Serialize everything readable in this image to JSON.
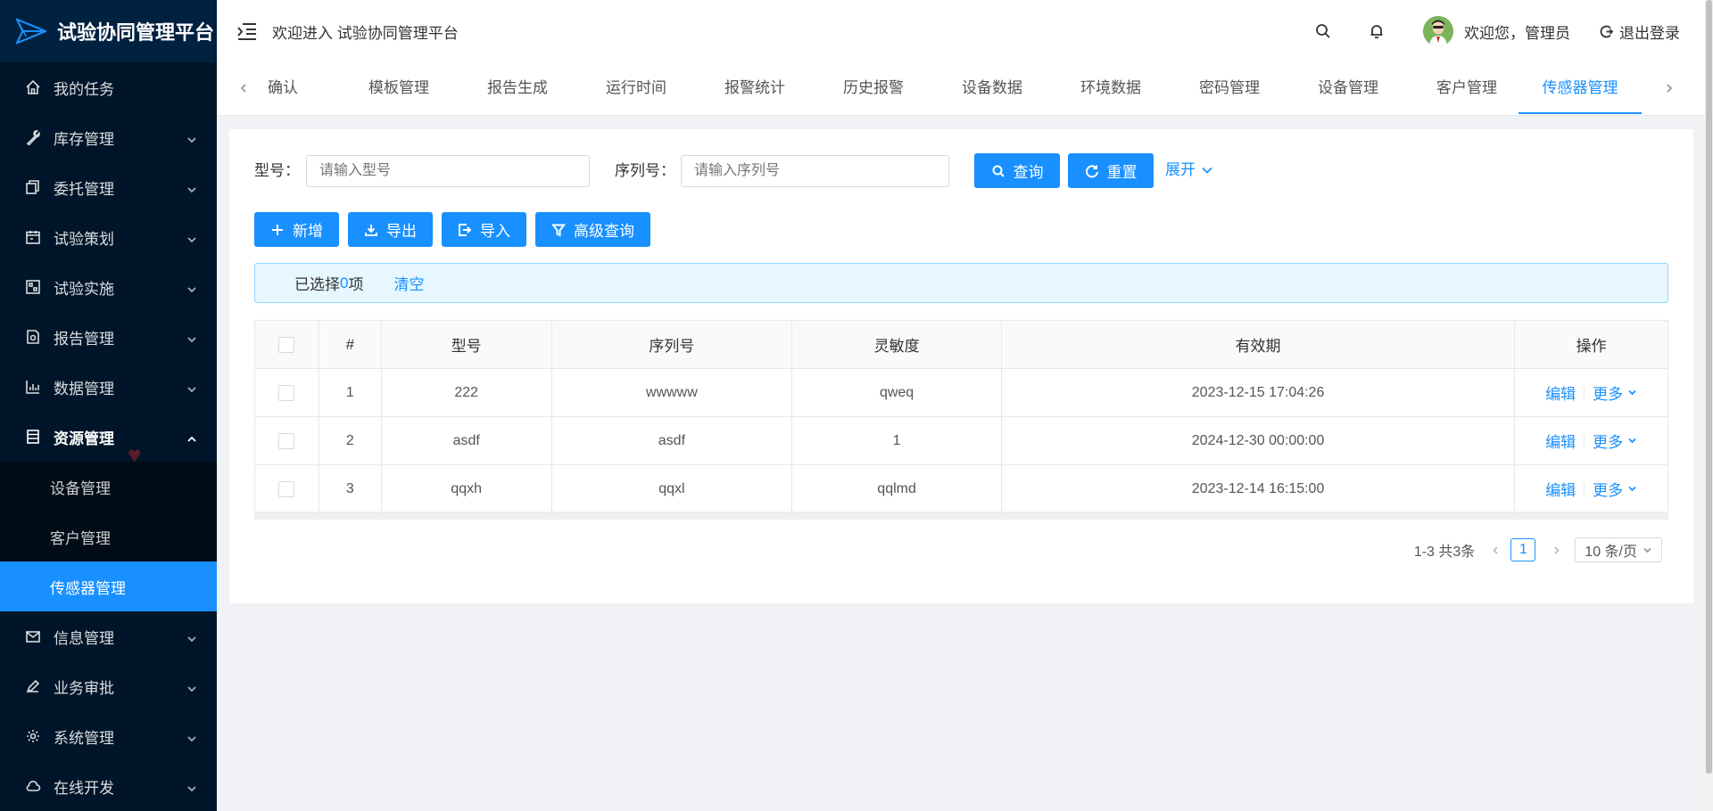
{
  "app": {
    "title": "试验协同管理平台"
  },
  "header": {
    "welcome": "欢迎进入 试验协同管理平台",
    "user_greeting": "欢迎您，管理员",
    "logout": "退出登录"
  },
  "sidebar": {
    "items": [
      {
        "label": "我的任务",
        "icon": "home-icon"
      },
      {
        "label": "库存管理",
        "icon": "wrench-icon"
      },
      {
        "label": "委托管理",
        "icon": "copy-icon"
      },
      {
        "label": "试验策划",
        "icon": "calendar-icon"
      },
      {
        "label": "试验实施",
        "icon": "grid-icon"
      },
      {
        "label": "报告管理",
        "icon": "report-icon"
      },
      {
        "label": "数据管理",
        "icon": "bar-chart-icon"
      },
      {
        "label": "资源管理",
        "icon": "database-icon"
      }
    ],
    "sub_items": [
      {
        "label": "设备管理"
      },
      {
        "label": "客户管理"
      },
      {
        "label": "传感器管理"
      }
    ],
    "items_after": [
      {
        "label": "信息管理",
        "icon": "mail-icon"
      },
      {
        "label": "业务审批",
        "icon": "pen-icon"
      },
      {
        "label": "系统管理",
        "icon": "gear-icon"
      },
      {
        "label": "在线开发",
        "icon": "cloud-icon"
      }
    ]
  },
  "tabs": [
    {
      "label": "确认"
    },
    {
      "label": "模板管理"
    },
    {
      "label": "报告生成"
    },
    {
      "label": "运行时间"
    },
    {
      "label": "报警统计"
    },
    {
      "label": "历史报警"
    },
    {
      "label": "设备数据"
    },
    {
      "label": "环境数据"
    },
    {
      "label": "密码管理"
    },
    {
      "label": "设备管理"
    },
    {
      "label": "客户管理"
    },
    {
      "label": "传感器管理"
    }
  ],
  "search": {
    "model_label": "型号：",
    "model_placeholder": "请输入型号",
    "serial_label": "序列号：",
    "serial_placeholder": "请输入序列号",
    "query": "查询",
    "reset": "重置",
    "expand": "展开"
  },
  "toolbar": {
    "add": "新增",
    "export": "导出",
    "import": "导入",
    "advanced": "高级查询"
  },
  "alert": {
    "prefix": "已选择",
    "count": "0",
    "suffix": "项",
    "clear": "清空"
  },
  "table": {
    "columns": [
      "#",
      "型号",
      "序列号",
      "灵敏度",
      "有效期",
      "操作"
    ],
    "rows": [
      {
        "index": "1",
        "model": "222",
        "serial": "wwwww",
        "sensitivity": "qweq",
        "expiry": "2023-12-15 17:04:26"
      },
      {
        "index": "2",
        "model": "asdf",
        "serial": "asdf",
        "sensitivity": "1",
        "expiry": "2024-12-30 00:00:00"
      },
      {
        "index": "3",
        "model": "qqxh",
        "serial": "qqxl",
        "sensitivity": "qqlmd",
        "expiry": "2023-12-14 16:15:00"
      }
    ],
    "edit": "编辑",
    "more": "更多"
  },
  "pagination": {
    "summary": "1-3 共3条",
    "current": "1",
    "page_size": "10 条/页"
  },
  "colors": {
    "sidebar_bg": "#001529",
    "accent": "#1890ff",
    "alert_bg": "#e6f7ff"
  }
}
